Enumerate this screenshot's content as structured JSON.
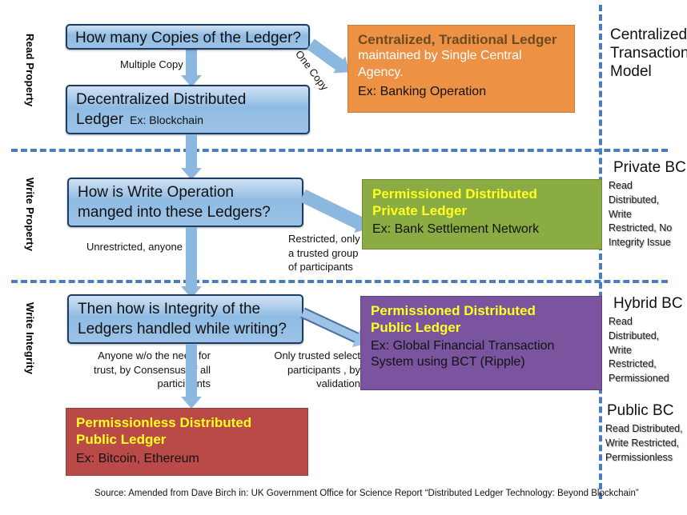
{
  "bands": [
    {
      "label": "Read Property"
    },
    {
      "label": "Write Property"
    },
    {
      "label": "Write Integrity"
    }
  ],
  "questions": {
    "q1": "How many Copies of the Ledger?",
    "q2_line1": "How is Write Operation",
    "q2_line2": "manged into these Ledgers?",
    "q3_line1": "Then how is Integrity of the",
    "q3_line2": "Ledgers handled while writing?"
  },
  "blue_box": {
    "line1": "Decentralized Distributed",
    "line2_main": "Ledger",
    "line2_small": "Ex: Blockchain"
  },
  "edge_labels": {
    "multiple_copy": "Multiple  Copy",
    "one_copy": "One Copy",
    "unrestricted": "Unrestricted, anyone",
    "restricted_l1": "Restricted, only",
    "restricted_l2": "a trusted group",
    "restricted_l3": "of participants",
    "anyone_l1": "Anyone w/o the need for",
    "anyone_l2": "trust, by Consensus of all",
    "anyone_l3": "participants",
    "trusted_l1": "Only trusted select",
    "trusted_l2": "participants , by",
    "trusted_l3": "validation"
  },
  "outcomes": {
    "orange": {
      "header": "Centralized,  Traditional Ledger",
      "body_l1": "maintained by  Single Central",
      "body_l2": "Agency.",
      "example": "Ex:  Banking Operation",
      "color": "#ed9145"
    },
    "green": {
      "header_l1": "Permissioned Distributed",
      "header_l2": "Private Ledger",
      "example": "Ex:  Bank Settlement Network",
      "color": "#8bab43"
    },
    "purple": {
      "header_l1": "Permissioned Distributed",
      "header_l2": "Public Ledger",
      "example_l1": "Ex: Global Financial Transaction",
      "example_l2": "System using BCT (Ripple)",
      "color": "#7a549e"
    },
    "red": {
      "header_l1": "Permissionless  Distributed",
      "header_l2": "Public Ledger",
      "example": "Ex: Bitcoin, Ethereum",
      "color": "#b94a48"
    }
  },
  "right_column": [
    {
      "title_l1": "Centralized",
      "title_l2": "Transaction",
      "title_l3": "Model",
      "sub": ""
    },
    {
      "title": "Private BC",
      "sub_l1": "Read",
      "sub_l2": "Distributed,",
      "sub_l3": "Write",
      "sub_l4": "Restricted, No",
      "sub_l5": "Integrity Issue"
    },
    {
      "title": "Hybrid BC",
      "sub_l1": "Read",
      "sub_l2": "Distributed,",
      "sub_l3": "Write",
      "sub_l4": "Restricted,",
      "sub_l5": "Permissioned"
    },
    {
      "title": "Public BC",
      "sub_l1": "Read Distributed,",
      "sub_l2": "Write Restricted,",
      "sub_l3": "Permissionless"
    }
  ],
  "source": "Source: Amended from Dave  Birch in:  UK Government Office for Science Report “Distributed Ledger Technology: Beyond Blockchain”",
  "colors": {
    "arrow": "#8cb8e0",
    "dashed": "#4a7ebb",
    "blue_box_border": "#1b3c63",
    "yellow_text": "#ffff21"
  }
}
